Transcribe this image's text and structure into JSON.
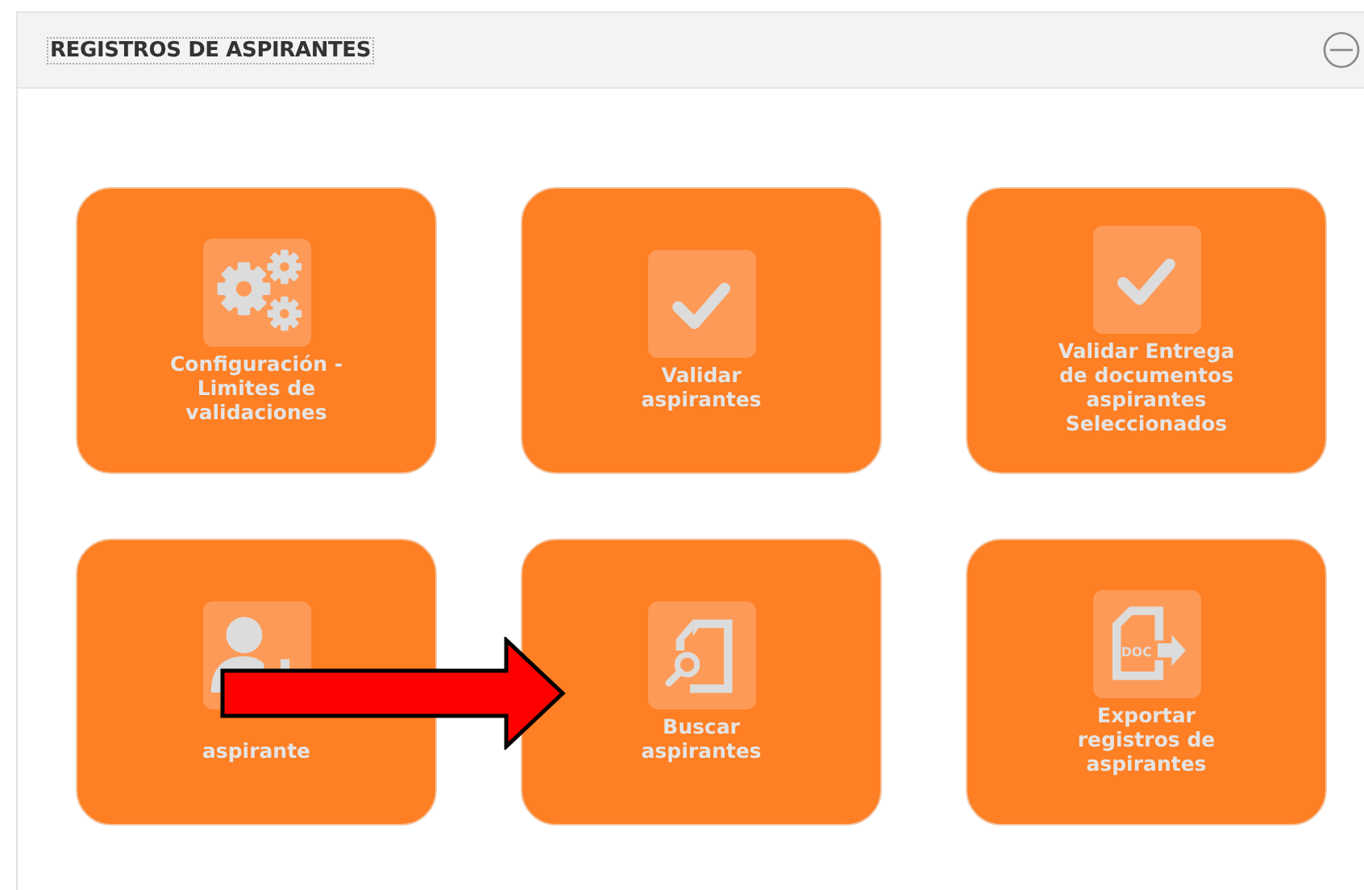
{
  "panel": {
    "title": "REGISTROS DE ASPIRANTES"
  },
  "cards": [
    {
      "kind": "gears",
      "lines": [
        "Configuración -",
        "Limites de",
        "validaciones"
      ]
    },
    {
      "kind": "check",
      "lines": [
        "Validar",
        "aspirantes"
      ]
    },
    {
      "kind": "check",
      "lines": [
        "Validar Entrega",
        "de documentos",
        "aspirantes",
        "Seleccionados"
      ]
    },
    {
      "kind": "user-plus",
      "lines": [
        "aspirante"
      ]
    },
    {
      "kind": "doc-search",
      "lines": [
        "Buscar",
        "aspirantes"
      ]
    },
    {
      "kind": "doc-export",
      "icon_text": "DOC",
      "lines": [
        "Exportar",
        "registros de",
        "aspirantes"
      ]
    }
  ]
}
